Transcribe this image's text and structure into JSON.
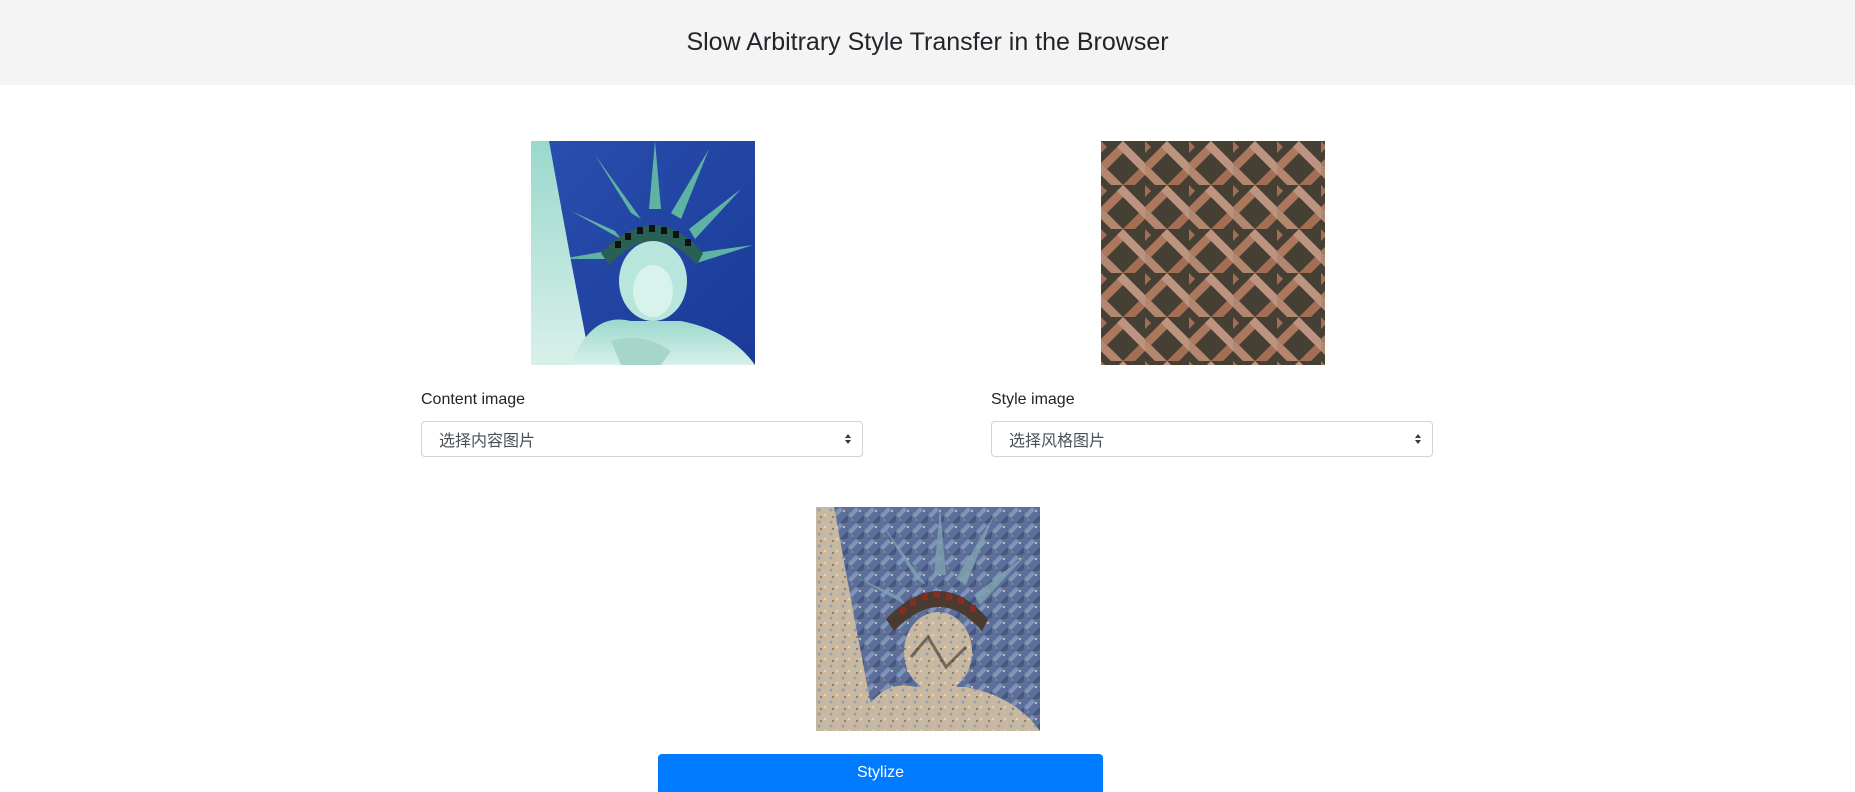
{
  "header": {
    "title": "Slow Arbitrary Style Transfer in the Browser"
  },
  "content": {
    "label": "Content image",
    "select_value": "选择内容图片"
  },
  "style": {
    "label": "Style image",
    "select_value": "选择风格图片"
  },
  "actions": {
    "stylize_label": "Stylize"
  },
  "colors": {
    "header_bg": "#f4f4f4",
    "button_primary": "#007bff"
  }
}
